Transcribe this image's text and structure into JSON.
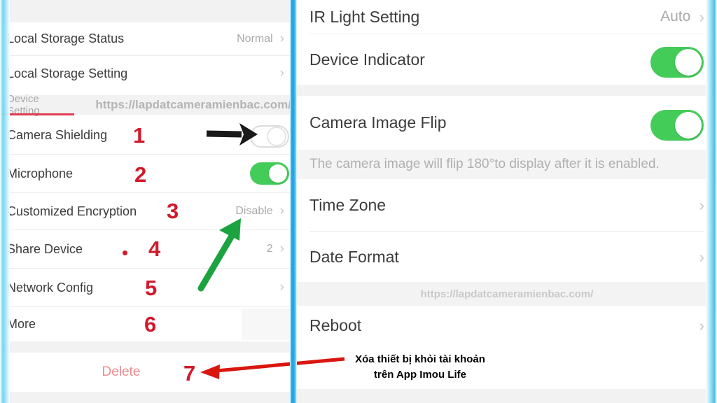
{
  "watermark": "https://lapdatcameramienbac.com/",
  "colors": {
    "toggle_on": "#44cc59",
    "marker_red": "#d11a2a",
    "arrow_green": "#1aa33f",
    "arrow_black": "#1a1a1a",
    "arrow_red": "#d9170f",
    "divider_blue": "#1fa3e4",
    "delete_red": "#f08a8f",
    "underline_red": "#e03b52"
  },
  "left_panel": {
    "top_rows": [
      {
        "label": "Local Storage Status",
        "value": "Normal",
        "chevron": "›",
        "toggle": null
      },
      {
        "label": "Local Storage Setting",
        "value": "",
        "chevron": "›",
        "toggle": null
      }
    ],
    "section_header": {
      "title": "Device Setting",
      "watermark": "https://lapdatcameramienbac.com/"
    },
    "rows": [
      {
        "label": "Camera Shielding",
        "value": "",
        "chevron": "",
        "toggle": "off",
        "marker": "1"
      },
      {
        "label": "Microphone",
        "value": "",
        "chevron": "",
        "toggle": "on",
        "marker": "2"
      },
      {
        "label": "Customized Encryption",
        "value": "Disable",
        "chevron": "›",
        "toggle": null,
        "marker": "3"
      },
      {
        "label": "Share Device",
        "value": "2",
        "chevron": "›",
        "toggle": null,
        "marker": "4"
      },
      {
        "label": "Network Config",
        "value": "",
        "chevron": "›",
        "toggle": null,
        "marker": "5"
      },
      {
        "label": "More",
        "value": "",
        "chevron": "",
        "toggle": null,
        "marker": "6"
      }
    ],
    "delete": {
      "label": "Delete",
      "marker": "7"
    }
  },
  "right_panel": {
    "rows": [
      {
        "label": "IR Light Setting",
        "value": "Auto",
        "chevron": "›",
        "toggle": null
      },
      {
        "label": "Device Indicator",
        "value": "",
        "chevron": "",
        "toggle": "on"
      },
      {
        "label": "Camera Image Flip",
        "value": "",
        "chevron": "",
        "toggle": "on"
      }
    ],
    "hint": "The camera image will flip 180°to display after it is enabled.",
    "rows2": [
      {
        "label": "Time Zone",
        "value": "",
        "chevron": "›"
      },
      {
        "label": "Date Format",
        "value": "",
        "chevron": "›"
      }
    ],
    "watermark": "https://lapdatcameramienbac.com/",
    "rows3": [
      {
        "label": "Reboot",
        "value": "",
        "chevron": "›"
      }
    ],
    "note": {
      "line1": "Xóa thiết bị khỏi tài khoản",
      "line2": "trên App Imou Life"
    }
  }
}
